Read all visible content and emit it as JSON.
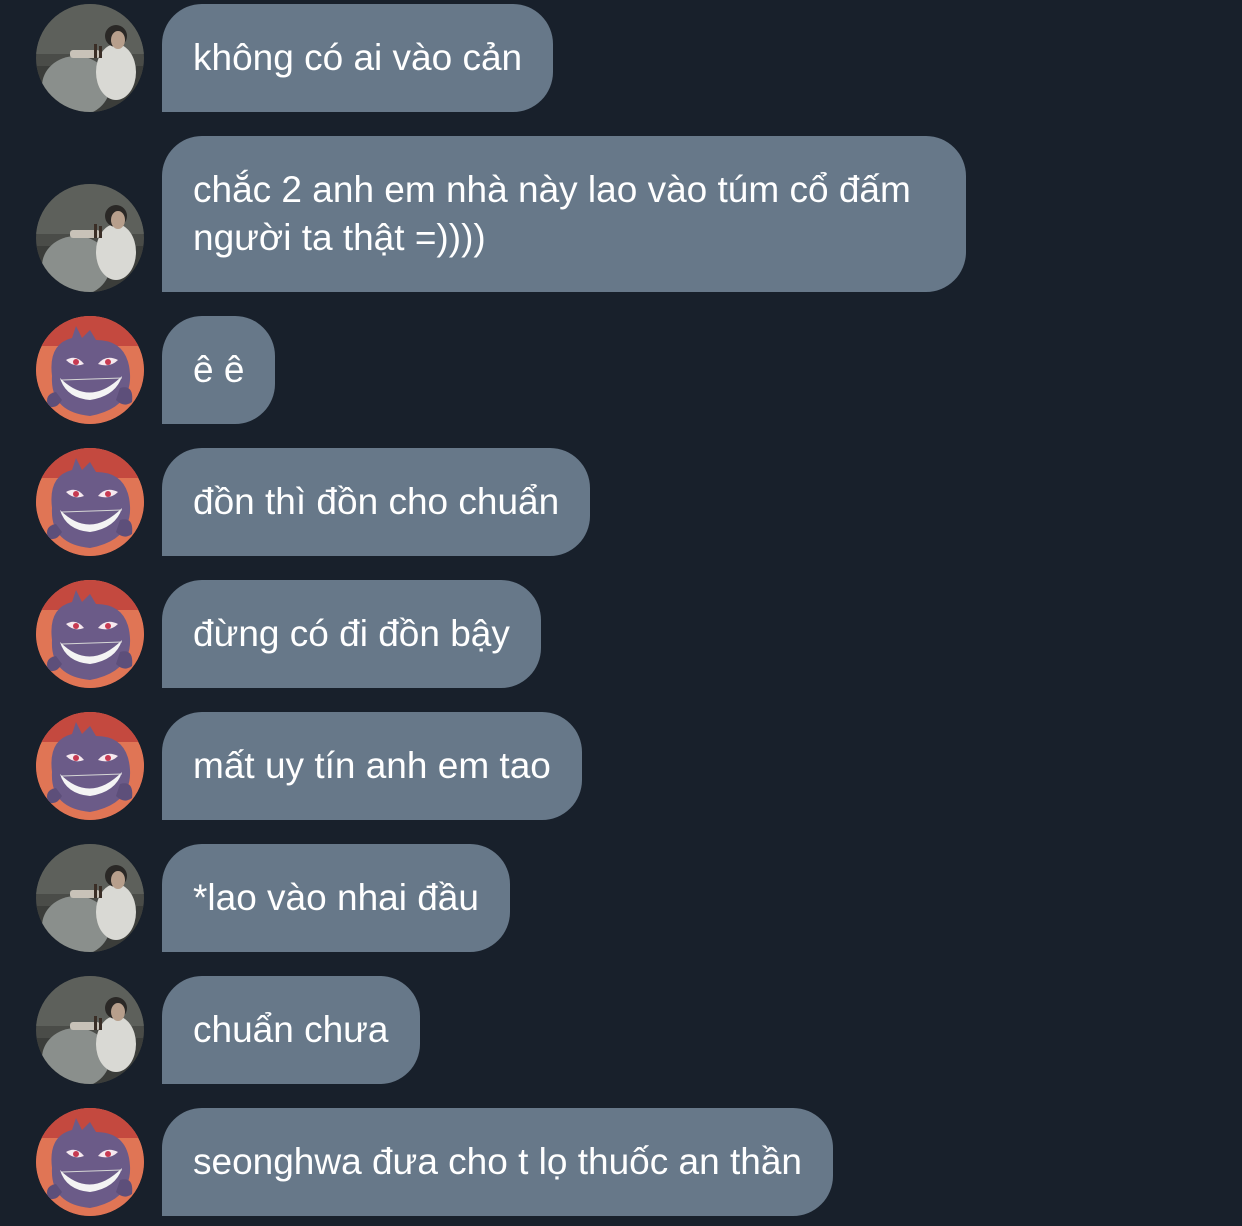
{
  "messages": [
    {
      "sender": "user-a",
      "text": "không có ai vào cản"
    },
    {
      "sender": "user-a",
      "text": "chắc 2 anh em nhà này lao vào túm cổ đấm người ta thật =))))"
    },
    {
      "sender": "user-b",
      "text": "ê ê"
    },
    {
      "sender": "user-b",
      "text": "đồn thì đồn cho chuẩn"
    },
    {
      "sender": "user-b",
      "text": "đừng có đi đồn bậy"
    },
    {
      "sender": "user-b",
      "text": "mất uy tín anh em tao"
    },
    {
      "sender": "user-a",
      "text": "*lao vào nhai đầu"
    },
    {
      "sender": "user-a",
      "text": "chuẩn chưa"
    },
    {
      "sender": "user-b",
      "text": "seonghwa đưa cho t lọ thuốc an thần"
    }
  ],
  "colors": {
    "background": "#18202b",
    "bubble": "#677889",
    "text": "#ffffff"
  },
  "icons": {
    "user-a": "person-photo-avatar",
    "user-b": "gengar-avatar"
  }
}
